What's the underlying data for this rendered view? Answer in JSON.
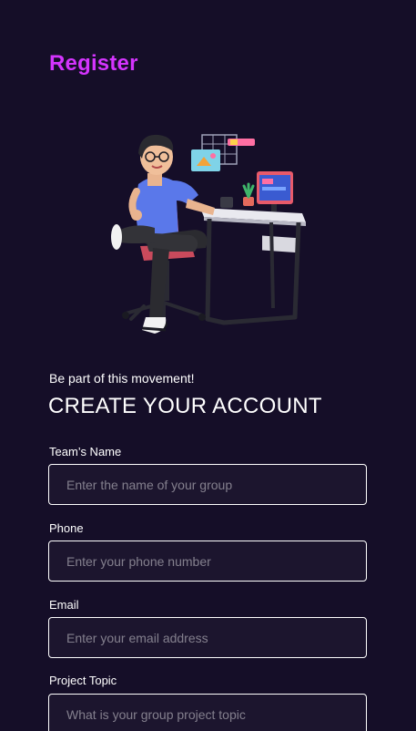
{
  "header": {
    "title": "Register"
  },
  "illustration": {
    "icon": "person-at-desk-illustration"
  },
  "form": {
    "tagline": "Be part of this movement!",
    "heading": "CREATE YOUR ACCOUNT",
    "fields": [
      {
        "label": "Team’s Name",
        "placeholder": "Enter the name of your group",
        "value": ""
      },
      {
        "label": "Phone",
        "placeholder": "Enter your phone number",
        "value": ""
      },
      {
        "label": "Email",
        "placeholder": "Enter your email address",
        "value": ""
      },
      {
        "label": "Project Topic",
        "placeholder": "What is your group project topic",
        "value": ""
      }
    ]
  },
  "colors": {
    "background": "#150e28",
    "accent": "#d434fe",
    "text": "#ffffff"
  }
}
